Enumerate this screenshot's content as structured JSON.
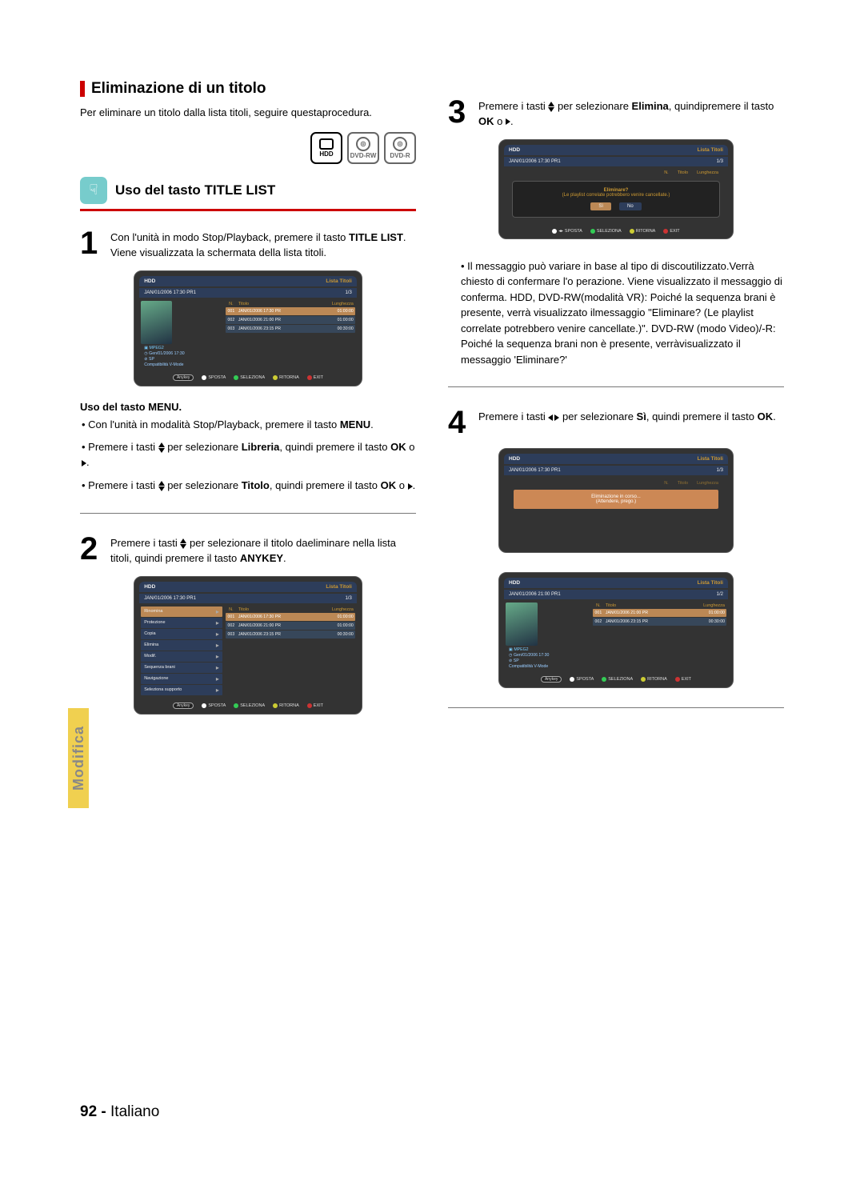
{
  "section": {
    "title": "Eliminazione di un titolo",
    "intro": "Per eliminare un titolo dalla lista titoli, seguire questaprocedura."
  },
  "discs": {
    "hdd": "HDD",
    "dvdrw": "DVD-RW",
    "dvdr": "DVD-R"
  },
  "subheading": "Uso del tasto TITLE LIST",
  "step1": {
    "num": "1",
    "pre": "Con l'unità in modo Stop/Playback, premere il tasto ",
    "bold": "TITLE LIST",
    "post": ". Viene visualizzata la schermata della lista titoli."
  },
  "osd": {
    "hdd": "HDD",
    "listatitoli": "Lista Titoli",
    "bar": "JAN/01/2006 17:30 PR1",
    "count13": "1/3",
    "count12": "1/2",
    "bar2": "JAN/01/2006 21:00 PR1",
    "col_n": "N.",
    "col_t": "Titolo",
    "col_l": "Lunghezza",
    "rows3": [
      {
        "n": "001",
        "t": "JAN/01/2006 17:30 PR",
        "l": "01:00:00"
      },
      {
        "n": "002",
        "t": "JAN/01/2006 21:00 PR",
        "l": "01:00:00"
      },
      {
        "n": "003",
        "t": "JAN/01/2006 23:15 PR",
        "l": "00:30:00"
      }
    ],
    "rows2": [
      {
        "n": "001",
        "t": "JAN/01/2006 21:00 PR",
        "l": "01:00:00"
      },
      {
        "n": "002",
        "t": "JAN/01/2006 23:15 PR",
        "l": "00:30:00"
      }
    ],
    "info": {
      "l1": "Gen/01/2006 17:30",
      "l2": "SP",
      "l3": "Compatibilità V-Mode",
      "mpeg": "MPEG2",
      "snd": ""
    },
    "foot": {
      "sposta": "SPOSTA",
      "seleziona": "SELEZIONA",
      "ritorna": "RITORNA",
      "exit": "EXIT",
      "anykey": "Anykey"
    },
    "context": [
      "Rinomina",
      "Protezione",
      "Copia",
      "Elimina",
      "Modif.",
      "Sequenza brani",
      "Navigazione",
      "Seleziona supporto"
    ]
  },
  "menu": {
    "title": "Uso del tasto MENU.",
    "b1a": "Con l'unità in modalità Stop/Playback, premere il tasto ",
    "b1b": "MENU",
    "b1c": ".",
    "b2a": "Premere i tasti ",
    "b2b": " per selezionare ",
    "b2c": "Libreria",
    "b2d": ", quindi premere il tasto ",
    "b2e": "OK",
    "b2f": " o ",
    "b3a": "Premere i tasti ",
    "b3b": " per selezionare ",
    "b3c": "Titolo",
    "b3d": ", quindi premere il tasto ",
    "b3e": "OK",
    "b3f": " o "
  },
  "step2": {
    "num": "2",
    "a": "Premere i tasti ",
    "b": " per selezionare il titolo daeliminare nella lista titoli, quindi premere il tasto ",
    "c": "ANYKEY",
    "d": "."
  },
  "step3": {
    "num": "3",
    "a": "Premere i tasti ",
    "b": " per selezionare ",
    "c": "Elimina",
    "d": ", quindipremere il tasto ",
    "e": "OK",
    "f": " o "
  },
  "dialog": {
    "line1": "Eliminare?",
    "line2": "(Le playlist correlate potrebbero venire cancellate.)",
    "si": "Sì",
    "no": "No"
  },
  "note": "Il messaggio può variare in base al tipo di discoutilizzato.Verrà chiesto di confermare l'o perazione. Viene visualizzato il messaggio di conferma. HDD, DVD-RW(modalità VR): Poiché la sequenza brani è presente, verrà visualizzato ilmessaggio \"Eliminare? (Le playlist correlate potrebbero venire cancellate.)\".\nDVD-RW (modo Video)/-R: Poiché la sequenza brani non è presente, verràvisualizzato il messaggio 'Eliminare?'",
  "step4": {
    "num": "4",
    "a": "Premere i tasti ",
    "b": " per selezionare ",
    "c": "Sì",
    "d": ", quindi premere il tasto ",
    "e": "OK",
    "f": "."
  },
  "progress": {
    "l1": "Eliminazione in corso...",
    "l2": "(Attendere, prego.)"
  },
  "sidetab": "Modifica",
  "pagefoot": {
    "num": "92 -",
    "lang": "Italiano"
  }
}
